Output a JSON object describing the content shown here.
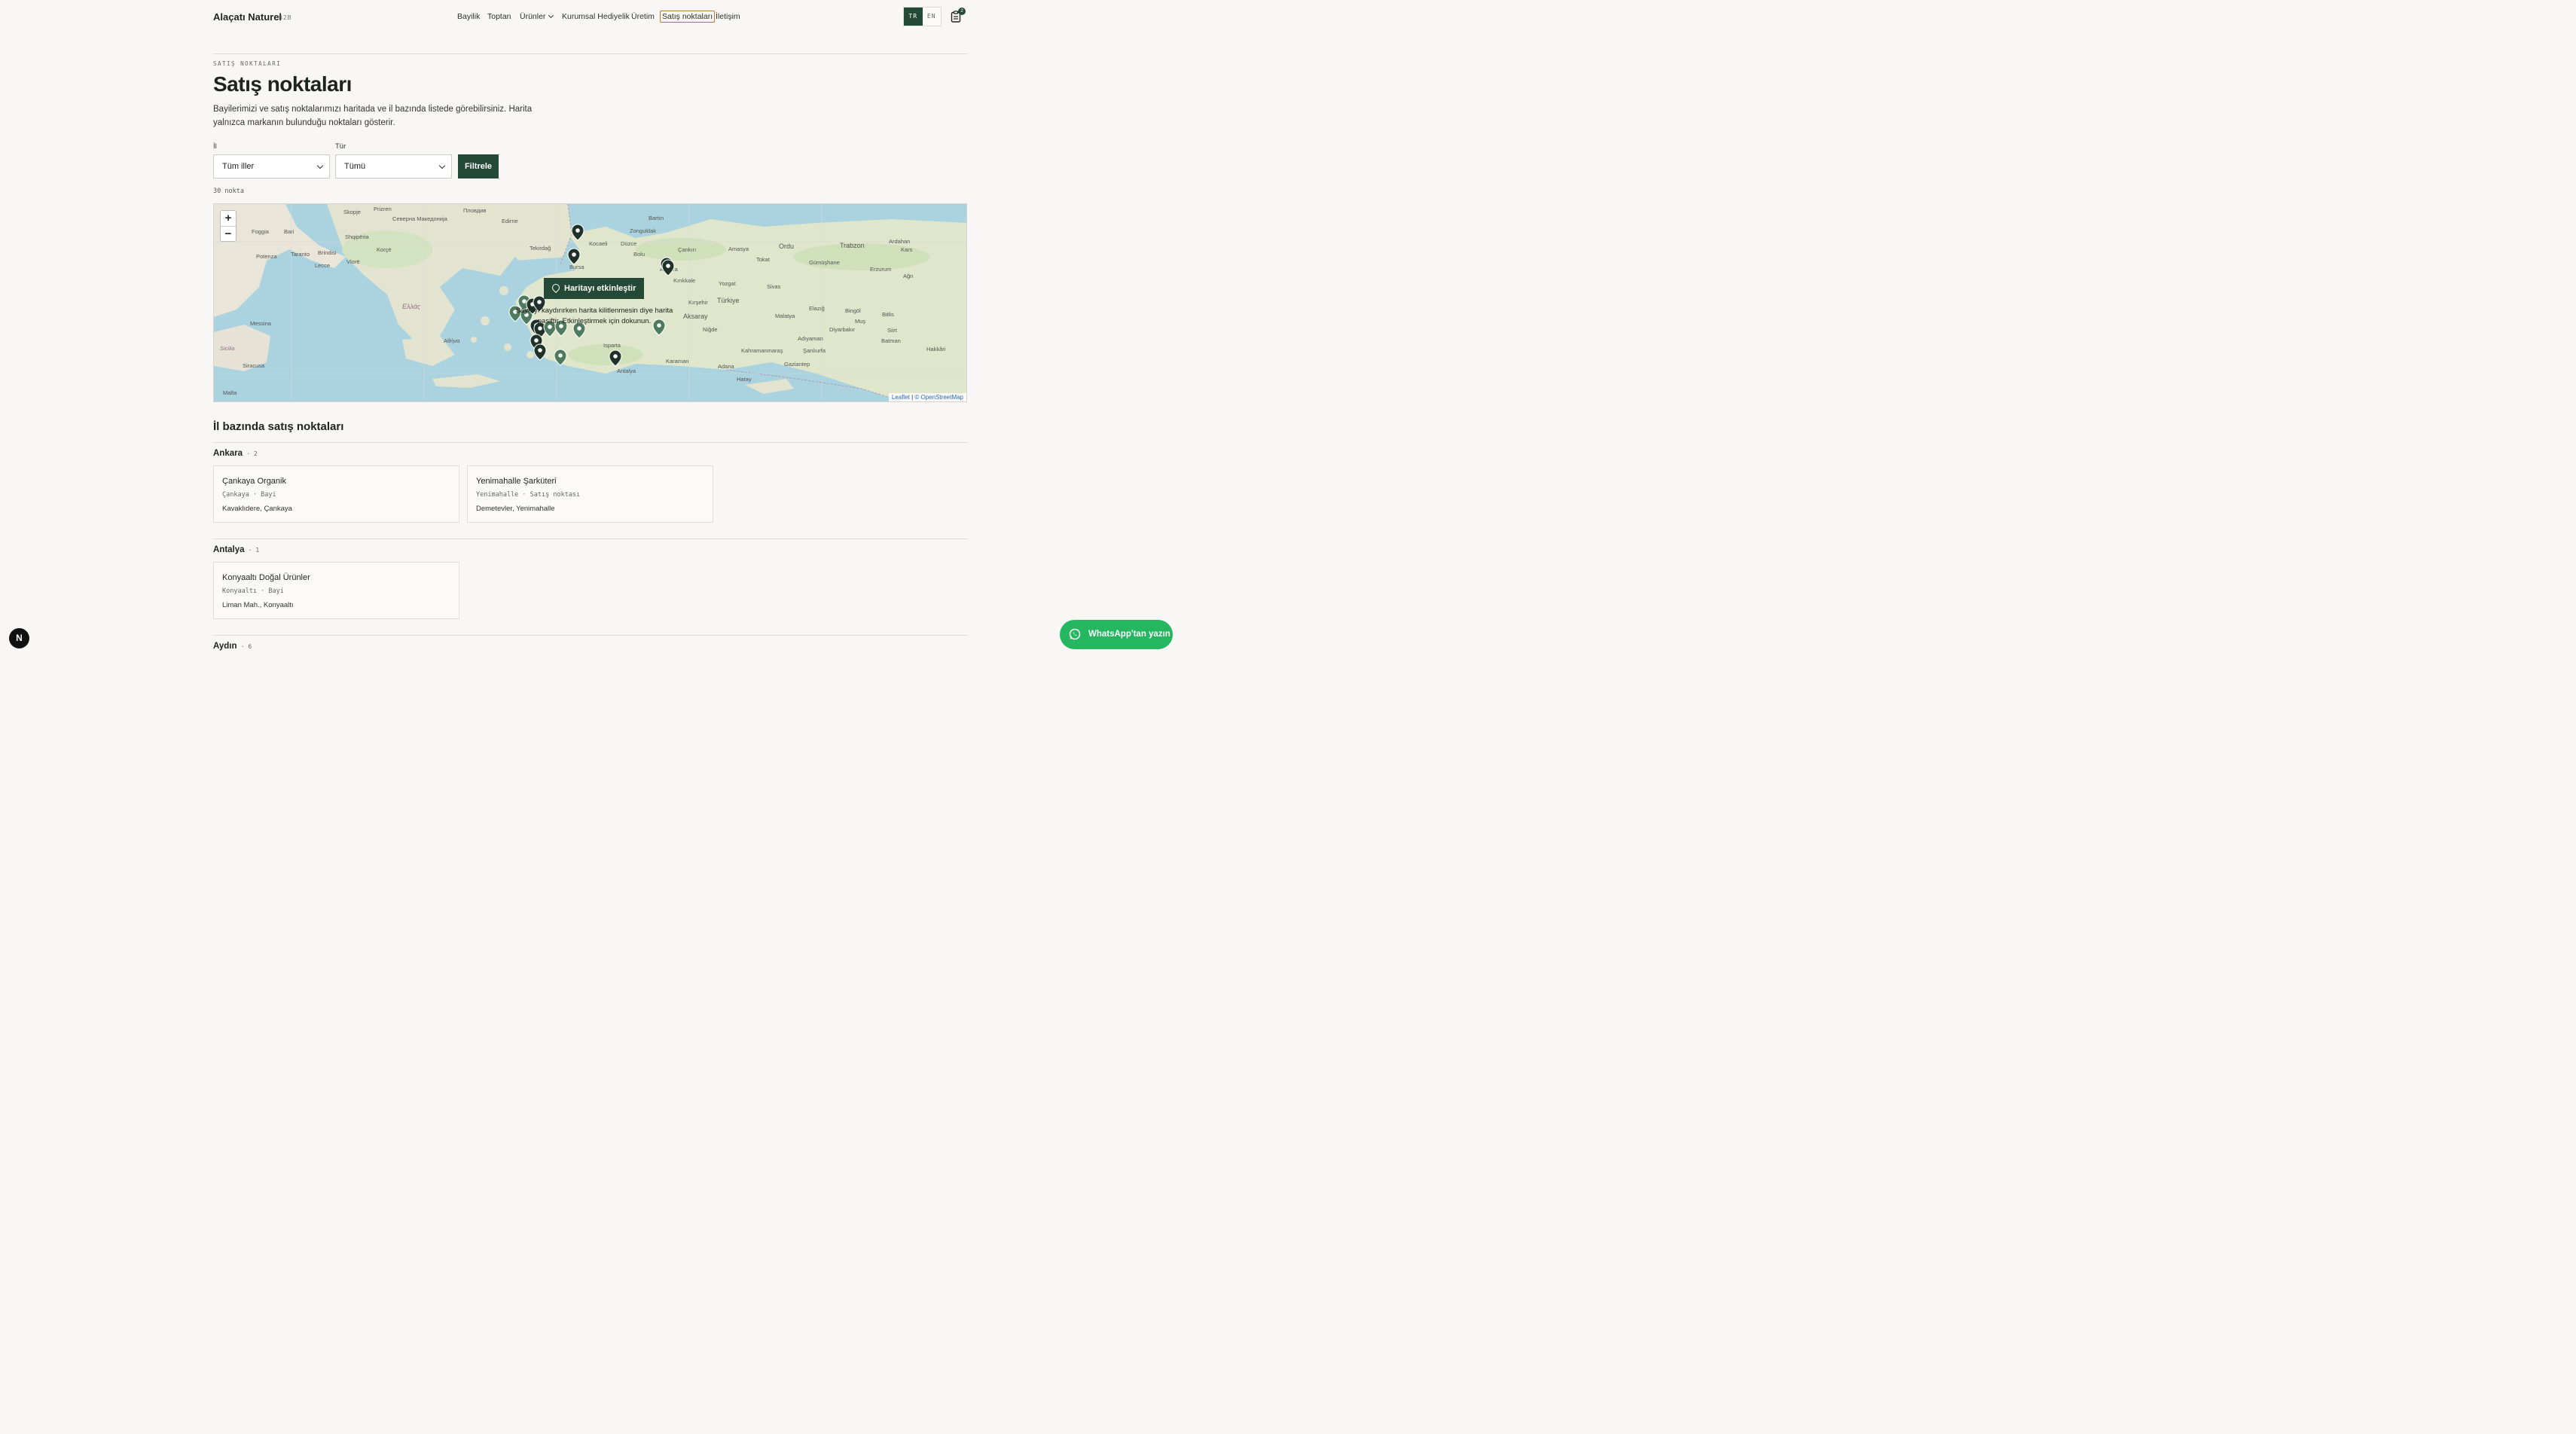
{
  "header": {
    "brand": "Alaçatı Naturel",
    "brand_sub": "B2B",
    "nav": [
      {
        "label": "Bayilik"
      },
      {
        "label": "Toptan"
      },
      {
        "label": "Ürünler"
      },
      {
        "label": "Kurumsal Hediyelik"
      },
      {
        "label": "Üretim"
      },
      {
        "label": "Satış noktaları"
      },
      {
        "label": "İletişim"
      }
    ],
    "lang_active": "TR",
    "lang_other": "EN",
    "cart_count": "2"
  },
  "page": {
    "eyebrow": "SATIŞ NOKTALARI",
    "title": "Satış noktaları",
    "intro": "Bayilerimizi ve satış noktalarımızı haritada ve il bazında listede görebilirsiniz. Harita yalnızca markanın bulunduğu noktaları gösterir."
  },
  "filters": {
    "province_label": "İl",
    "province_value": "Tüm iller",
    "type_label": "Tür",
    "type_value": "Tümü",
    "submit": "Filtrele",
    "count": "30 nokta"
  },
  "map": {
    "activate": "Haritayı etkinleştir",
    "hint": "Sayfayı kaydırırken harita kilitlenmesin diye harita pasiftir. Etkinleştirmek için dokunun.",
    "zoom_in": "+",
    "zoom_out": "−",
    "attribution_leaflet": "Leaflet",
    "attribution_osm": "© OpenStreetMap",
    "places": [
      "Prizren",
      "Пловдив",
      "Skopje",
      "Северна Македонија",
      "Shqipëria",
      "Foggia",
      "Bari",
      "Brindisi",
      "Taranto",
      "Lecce",
      "Potenza",
      "Vlorë",
      "Korçë",
      "Ελλάς",
      "Αθήνα",
      "Messina",
      "Sicilia",
      "Siracusa",
      "Malta",
      "Tekirdağ",
      "Bursa",
      "Kocaeli",
      "Düzce",
      "Bolu",
      "Zonguldak",
      "Bartın",
      "Ankara",
      "Kırıkkale",
      "Çankırı",
      "Amasya",
      "Tokat",
      "Ordu",
      "Trabzon",
      "Gümüşhane",
      "Erzurum",
      "Sivas",
      "Türkiye",
      "Kırşehir",
      "Aksaray",
      "Niğde",
      "Karaman",
      "Isparta",
      "Antalya",
      "Adana",
      "Hatay",
      "Kahramanmaraş",
      "Gaziantep",
      "Adıyaman",
      "Elazığ",
      "Batman",
      "Siirt",
      "Bitlis",
      "Hakkâri",
      "Ardahan",
      "Kars",
      "Ağrı",
      "Yozgat",
      "Malatya",
      "Diyarbakır",
      "Şanlıurfa",
      "Bingöl",
      "Muş",
      "Edirne",
      "Hatay"
    ]
  },
  "list": {
    "title": "İl bazında satış noktaları",
    "groups": [
      {
        "province": "Ankara",
        "count": "2",
        "items": [
          {
            "name": "Çankaya Organik",
            "meta": "Çankaya · Bayi",
            "address": "Kavaklıdere, Çankaya"
          },
          {
            "name": "Yenimahalle Şarküteri",
            "meta": "Yenimahalle · Satış noktası",
            "address": "Demetevler, Yenimahalle"
          }
        ]
      },
      {
        "province": "Antalya",
        "count": "1",
        "items": [
          {
            "name": "Konyaaltı Doğal Ürünler",
            "meta": "Konyaaltı · Bayi",
            "address": "Liman Mah., Konyaaltı"
          }
        ]
      },
      {
        "province": "Aydın",
        "count": "6",
        "items": []
      }
    ]
  },
  "overlay": {
    "next_badge": "N",
    "whatsapp": "WhatsApp'tan yazın"
  },
  "colors": {
    "brand_green": "#244a37",
    "active_nav_border": "#b7792e",
    "whatsapp": "#25b660"
  }
}
